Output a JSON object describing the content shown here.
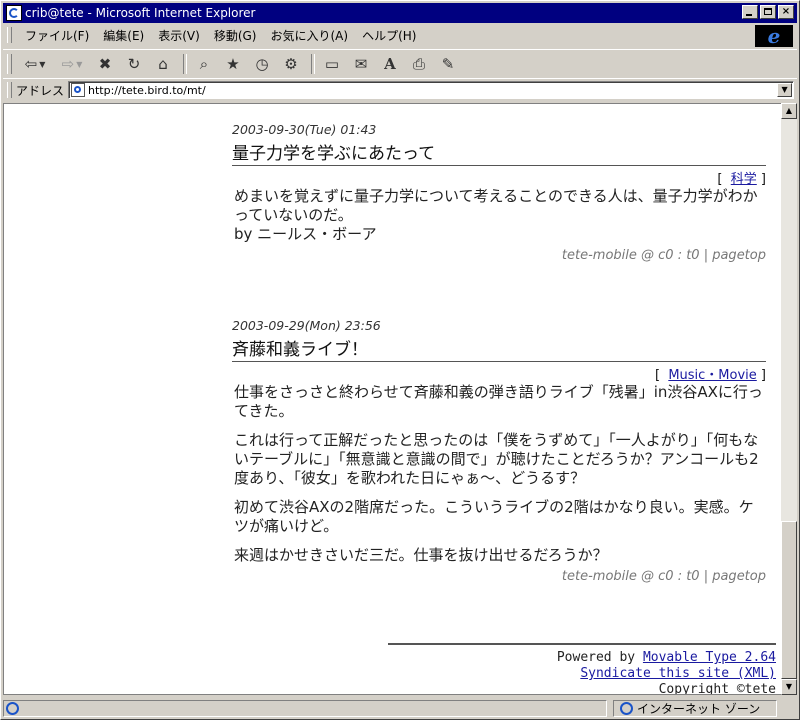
{
  "window": {
    "title": "crib@tete - Microsoft Internet Explorer",
    "controls": {
      "minimize": "_",
      "maximize": "□",
      "close": "×"
    }
  },
  "menu": [
    "ファイル(F)",
    "編集(E)",
    "表示(V)",
    "移動(G)",
    "お気に入り(A)",
    "ヘルプ(H)"
  ],
  "toolbar": {
    "back": "⇦",
    "forward": "⇨",
    "stop": "✖",
    "refresh": "↻",
    "home": "⌂",
    "search": "⌕",
    "favorites": "★",
    "history": "◷",
    "channels": "⚙",
    "fullscreen": "▭",
    "mail": "✉",
    "font": "A",
    "print": "⎙",
    "edit": "✎"
  },
  "address": {
    "label": "アドレス",
    "url": "http://tete.bird.to/mt/"
  },
  "entries": [
    {
      "date": "2003-09-30(Tue) 01:43",
      "title": "量子力学を学ぶにあたって",
      "category": "科学",
      "paragraphs": [
        "めまいを覚えずに量子力学について考えることのできる人は、量子力学がわかっていないのだ。\nby ニールス・ボーア"
      ],
      "meta": "tete-mobile @ c0 : t0 | pagetop"
    },
    {
      "date": "2003-09-29(Mon) 23:56",
      "title": "斉藤和義ライブ！",
      "category": "Music・Movie",
      "paragraphs": [
        "仕事をさっさと終わらせて斉藤和義の弾き語りライブ「残暑」in渋谷AXに行ってきた。",
        "これは行って正解だったと思ったのは「僕をうずめて」「一人よがり」「何もないテーブルに」「無意識と意識の間で」が聴けたことだろうか？アンコールも2度あり、「彼女」を歌われた日にゃぁ〜、どうるす？",
        "初めて渋谷AXの2階席だった。こういうライブの2階はかなり良い。実感。ケツが痛いけど。",
        "来週はかせきさいだ三だ。仕事を抜け出せるだろうか？"
      ],
      "meta": "tete-mobile @ c0 : t0 | pagetop"
    }
  ],
  "footer": {
    "powered_prefix": "Powered by ",
    "powered_link": "Movable Type 2.64",
    "syndicate": "Syndicate this site (XML)",
    "copyright": "Copyright ©tete"
  },
  "status": {
    "zone": "インターネット ゾーン"
  }
}
